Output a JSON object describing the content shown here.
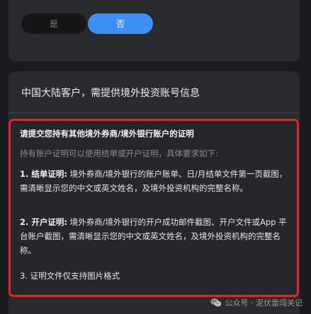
{
  "toggle": {
    "yes_label": "是",
    "no_label": "否",
    "selected": "否"
  },
  "section": {
    "title": "中国大陆客户，需提供境外投资账号信息"
  },
  "requirements": {
    "heading": "请提交您持有其他境外券商/境外银行账户的证明",
    "subtitle": "持有账户证明可以使用结单或开户证明，具体要求如下:",
    "item1_label": "1. 结单证明:",
    "item1_text": " 境外券商/境外银行的账户账单、日/月结单文件第一页截图，需清晰显示您的中文或英文姓名，及境外投资机构的完整名称。",
    "item2_label": "2. 开户证明:",
    "item2_text": " 境外券商/境外银行的开户成功邮件截图、开户文件或App 平台账户截图，需清晰显示您的中文或英文姓名，及境外投资机构的完整名称。",
    "item3_text": "3. 证明文件仅支持图片格式"
  },
  "watermark": {
    "text": "公众号 · 泥伏雷闯关记",
    "icon": "wechat-icon"
  },
  "colors": {
    "accent": "#3d8ef5",
    "highlight_border": "#e1262b",
    "card_bg": "#2a2b2f",
    "page_bg": "#1a1b1e"
  }
}
